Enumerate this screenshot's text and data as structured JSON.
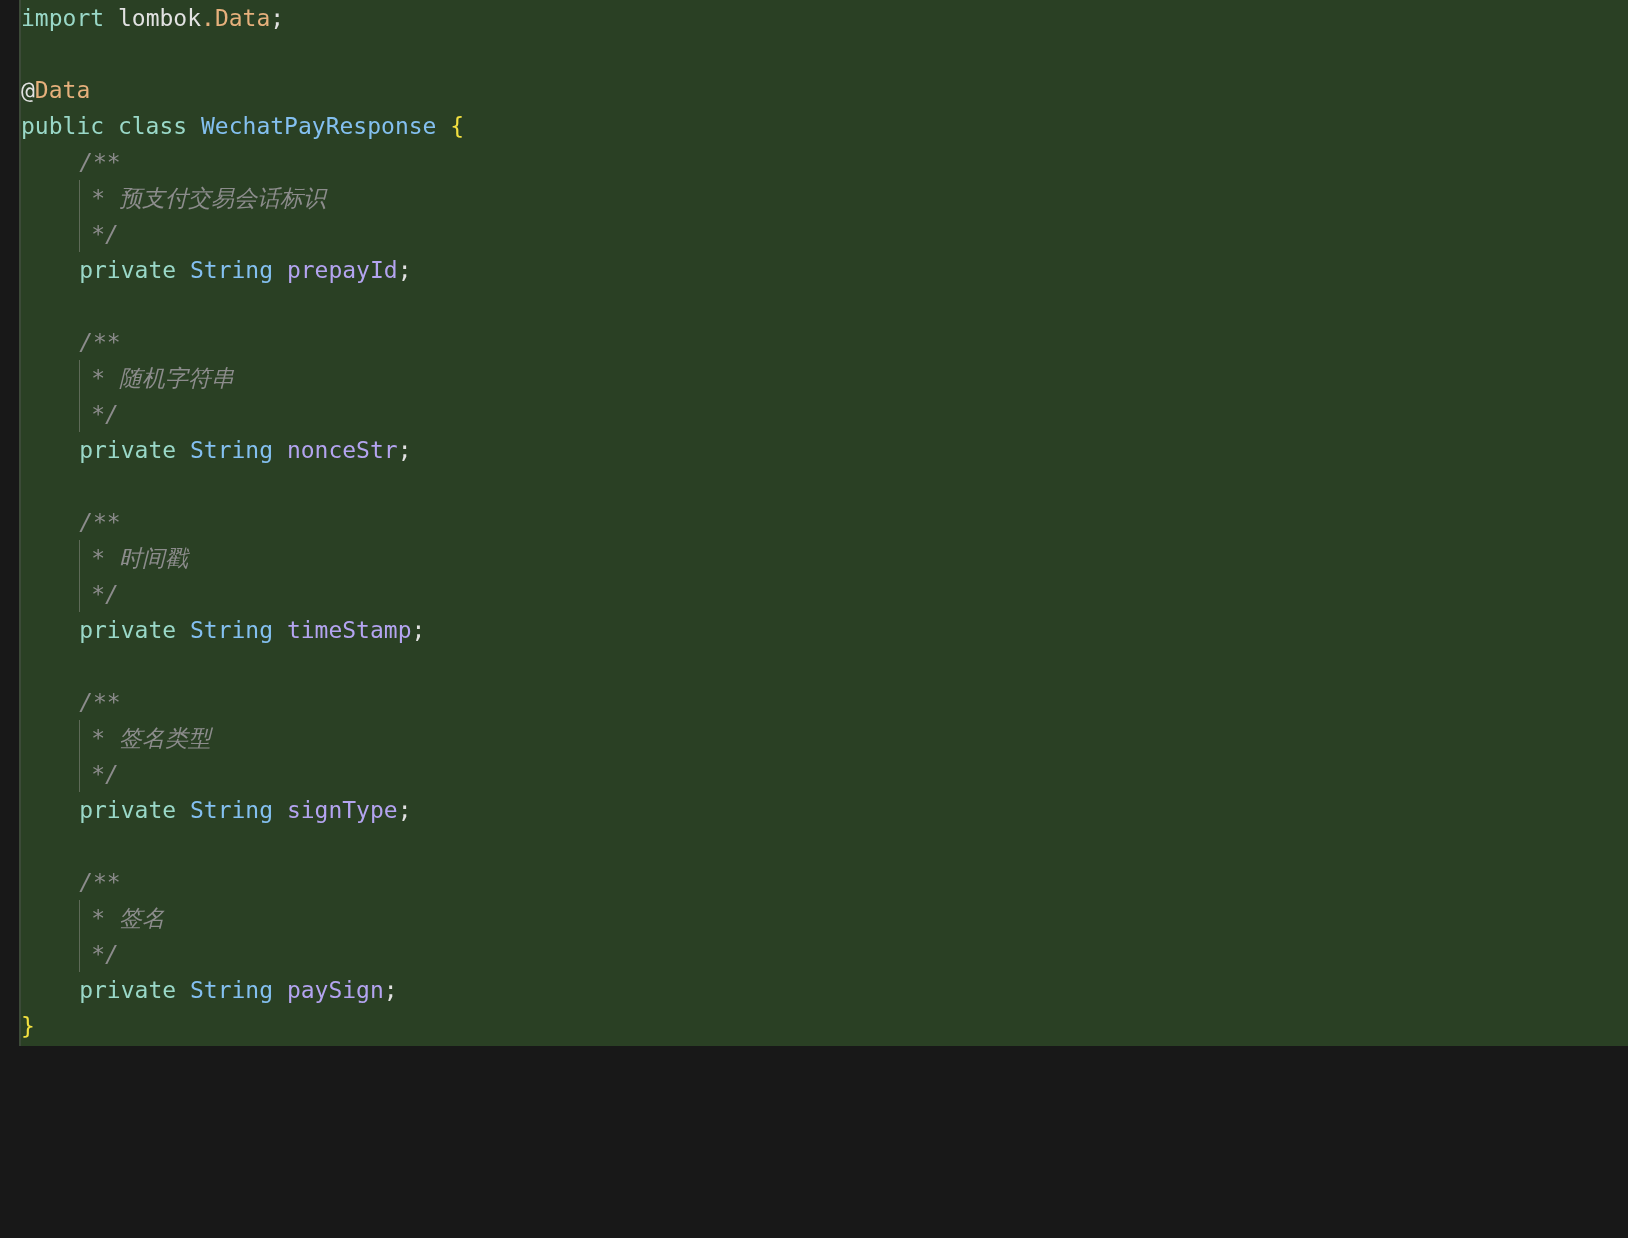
{
  "editor": {
    "lines": [
      {
        "kind": "top",
        "tokens": [
          {
            "kind": "keyword",
            "text": "import "
          },
          {
            "kind": "plain",
            "text": "lombok"
          },
          {
            "kind": "annotation",
            "text": ".Data"
          },
          {
            "kind": "plain",
            "text": ";"
          }
        ]
      },
      {
        "kind": "blank"
      },
      {
        "kind": "top",
        "tokens": [
          {
            "kind": "plain",
            "text": "@"
          },
          {
            "kind": "annotation",
            "text": "Data"
          }
        ]
      },
      {
        "kind": "top",
        "tokens": [
          {
            "kind": "keyword",
            "text": "public class "
          },
          {
            "kind": "type",
            "text": "WechatPayResponse "
          },
          {
            "kind": "brace",
            "text": "{"
          }
        ]
      },
      {
        "kind": "member",
        "tokens": [
          {
            "kind": "comment",
            "text": "/**"
          }
        ]
      },
      {
        "kind": "doc",
        "tokens": [
          {
            "kind": "comment",
            "text": "* 预支付交易会话标识"
          }
        ]
      },
      {
        "kind": "doc",
        "tokens": [
          {
            "kind": "comment",
            "text": "*/"
          }
        ]
      },
      {
        "kind": "member",
        "tokens": [
          {
            "kind": "keyword",
            "text": "private "
          },
          {
            "kind": "type",
            "text": "String "
          },
          {
            "kind": "field",
            "text": "prepayId"
          },
          {
            "kind": "plain",
            "text": ";"
          }
        ]
      },
      {
        "kind": "blank"
      },
      {
        "kind": "member",
        "tokens": [
          {
            "kind": "comment",
            "text": "/**"
          }
        ]
      },
      {
        "kind": "doc",
        "tokens": [
          {
            "kind": "comment",
            "text": "* 随机字符串"
          }
        ]
      },
      {
        "kind": "doc",
        "tokens": [
          {
            "kind": "comment",
            "text": "*/"
          }
        ]
      },
      {
        "kind": "member",
        "tokens": [
          {
            "kind": "keyword",
            "text": "private "
          },
          {
            "kind": "type",
            "text": "String "
          },
          {
            "kind": "field",
            "text": "nonceStr"
          },
          {
            "kind": "plain",
            "text": ";"
          }
        ]
      },
      {
        "kind": "blank"
      },
      {
        "kind": "member",
        "tokens": [
          {
            "kind": "comment",
            "text": "/**"
          }
        ]
      },
      {
        "kind": "doc",
        "tokens": [
          {
            "kind": "comment",
            "text": "* 时间戳"
          }
        ]
      },
      {
        "kind": "doc",
        "tokens": [
          {
            "kind": "comment",
            "text": "*/"
          }
        ]
      },
      {
        "kind": "member",
        "tokens": [
          {
            "kind": "keyword",
            "text": "private "
          },
          {
            "kind": "type",
            "text": "String "
          },
          {
            "kind": "field",
            "text": "timeStamp"
          },
          {
            "kind": "plain",
            "text": ";"
          }
        ]
      },
      {
        "kind": "blank"
      },
      {
        "kind": "member",
        "tokens": [
          {
            "kind": "comment",
            "text": "/**"
          }
        ]
      },
      {
        "kind": "doc",
        "tokens": [
          {
            "kind": "comment",
            "text": "* 签名类型"
          }
        ]
      },
      {
        "kind": "doc",
        "tokens": [
          {
            "kind": "comment",
            "text": "*/"
          }
        ]
      },
      {
        "kind": "member",
        "tokens": [
          {
            "kind": "keyword",
            "text": "private "
          },
          {
            "kind": "type",
            "text": "String "
          },
          {
            "kind": "field",
            "text": "signType"
          },
          {
            "kind": "plain",
            "text": ";"
          }
        ]
      },
      {
        "kind": "blank"
      },
      {
        "kind": "member",
        "tokens": [
          {
            "kind": "comment",
            "text": "/**"
          }
        ]
      },
      {
        "kind": "doc",
        "tokens": [
          {
            "kind": "comment",
            "text": "* 签名"
          }
        ]
      },
      {
        "kind": "doc",
        "tokens": [
          {
            "kind": "comment",
            "text": "*/"
          }
        ]
      },
      {
        "kind": "member",
        "tokens": [
          {
            "kind": "keyword",
            "text": "private "
          },
          {
            "kind": "type",
            "text": "String "
          },
          {
            "kind": "field",
            "text": "paySign"
          },
          {
            "kind": "plain",
            "text": ";"
          }
        ]
      },
      {
        "kind": "top",
        "tokens": [
          {
            "kind": "brace",
            "text": "}"
          }
        ]
      }
    ]
  }
}
